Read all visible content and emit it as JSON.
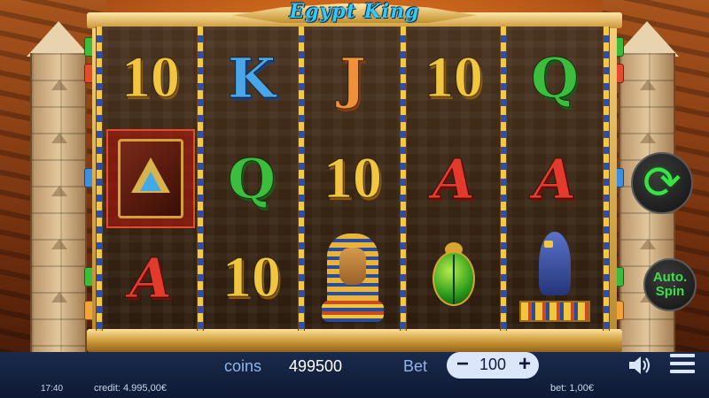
{
  "game": {
    "title": "Egypt King"
  },
  "reels": [
    [
      "10",
      "book",
      "A"
    ],
    [
      "K",
      "Q",
      "10"
    ],
    [
      "J",
      "10",
      "pharaoh"
    ],
    [
      "10",
      "A",
      "scarab"
    ],
    [
      "Q",
      "A",
      "falcon"
    ]
  ],
  "symbols": {
    "book": "book-icon",
    "pharaoh": "pharaoh-icon",
    "scarab": "scarab-icon",
    "falcon": "falcon-icon"
  },
  "controls": {
    "spin_icon": "refresh-icon",
    "auto_spin_label": "Auto.\nSpin",
    "sound_icon": "speaker-icon",
    "menu_icon": "hamburger-icon"
  },
  "status": {
    "coins_label": "coins",
    "coins_value": "499500",
    "bet_label": "Bet",
    "bet_value": "100",
    "bet_minus": "−",
    "bet_plus": "+",
    "time": "17:40",
    "credit": "credit: 4.995,00€",
    "bet_info": "bet: 1,00€"
  },
  "colors": {
    "spin_green": "#3ee04a",
    "bar_blue": "#1a2a4c",
    "gold": "#f2c53e"
  }
}
